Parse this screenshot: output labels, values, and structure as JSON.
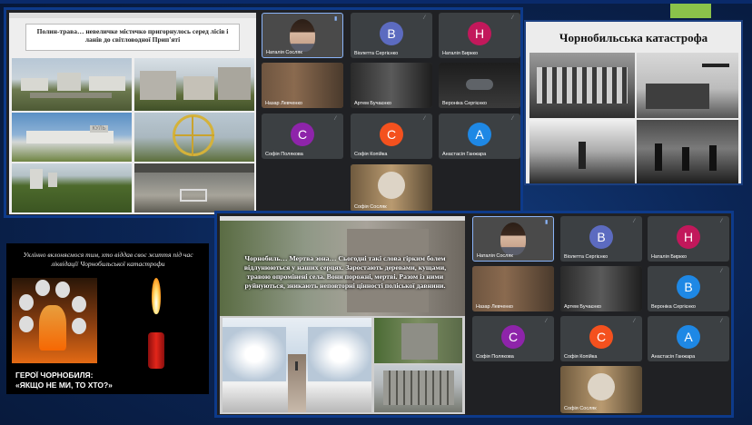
{
  "top_left": {
    "slide_caption": "Полин-трава… невеличке містечко пригорнулось серед лісів і ланів до світловодної Прип'яті",
    "tiles": [
      {
        "name": "Наталія Сосляк",
        "type": "video"
      },
      {
        "name": "Віолетта Сергієнко",
        "initial": "В",
        "color": "#5c6bc0"
      },
      {
        "name": "Наталія Биркко",
        "initial": "Н",
        "color": "#c2185b"
      },
      {
        "name": "Назар Левченко",
        "type": "video"
      },
      {
        "name": "Артем Бучаєнко",
        "type": "video"
      },
      {
        "name": "Вероніка Сергієнко",
        "type": "video"
      },
      {
        "name": "Софія Полякова",
        "initial": "С",
        "color": "#8e24aa"
      },
      {
        "name": "Софія Копійка",
        "initial": "С",
        "color": "#f4511e"
      },
      {
        "name": "Анастасія Ганжара",
        "initial": "А",
        "color": "#1e88e5"
      },
      {
        "name": "Софія Сосляк",
        "type": "video"
      }
    ]
  },
  "top_right": {
    "title": "Чорнобильська катастрофа"
  },
  "bottom_left": {
    "tribute": "Уклінно вклоняємося тим, хто віддав своє життя під час ліквідації Чорнобильської катастрофи",
    "heroes_line1": "ГЕРОЇ ЧОРНОБИЛЯ:",
    "heroes_line2": "«ЯКЩО НЕ МИ, ТО ХТО?»"
  },
  "bottom_right": {
    "slide_text": "Чорнобиль… Мертва зона… Сьогодні такі слова гірким болем відлунюються у наших серцях. Заростають деревами, кущами, травою опромінені села. Вони порожні, мертві. Разом із ними руйнуються, зникають неповторні цінності поліської давнини.",
    "tiles": [
      {
        "name": "Наталія Сосляк",
        "type": "video"
      },
      {
        "name": "Віолетта Сергієнко",
        "initial": "В",
        "color": "#5c6bc0"
      },
      {
        "name": "Наталія Биркко",
        "initial": "Н",
        "color": "#c2185b"
      },
      {
        "name": "Назар Левченко",
        "type": "video"
      },
      {
        "name": "Артем Бучаєнко",
        "type": "video"
      },
      {
        "name": "Вероніка Сергієнко",
        "initial": "В",
        "color": "#1e88e5"
      },
      {
        "name": "Софія Полякова",
        "initial": "С",
        "color": "#8e24aa"
      },
      {
        "name": "Софія Копійка",
        "initial": "С",
        "color": "#f4511e"
      },
      {
        "name": "Анастасія Ганжара",
        "initial": "А",
        "color": "#1e88e5"
      },
      {
        "name": "Софія Сосляк",
        "type": "video"
      }
    ]
  }
}
